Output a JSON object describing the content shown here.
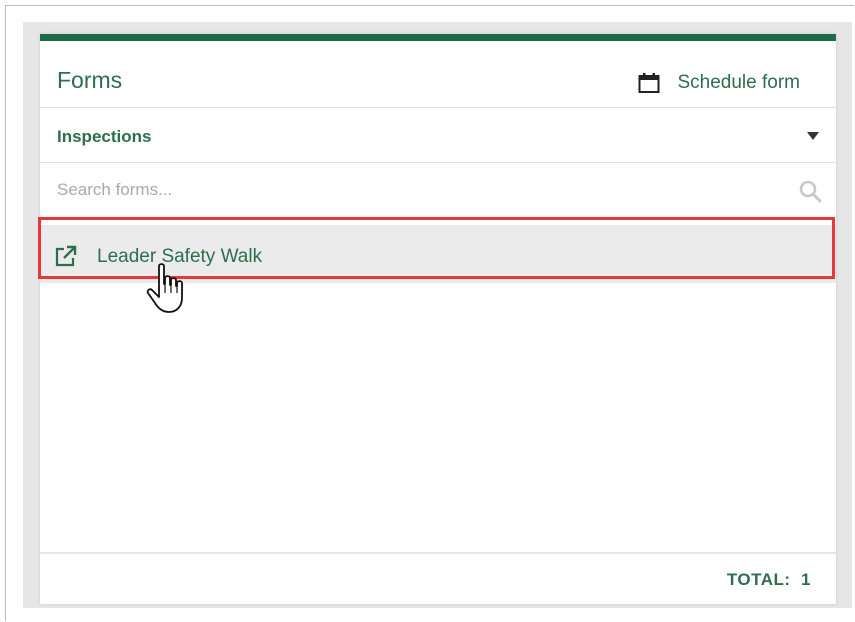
{
  "panel": {
    "title": "Forms",
    "accent_color": "#1e6b47",
    "schedule_button": {
      "label": "Schedule form",
      "icon": "calendar-icon"
    }
  },
  "category_select": {
    "selected": "Inspections",
    "icon": "caret-down-icon"
  },
  "search": {
    "placeholder": "Search forms...",
    "value": "",
    "icon": "search-icon"
  },
  "form_list": [
    {
      "label": "Leader Safety Walk",
      "icon": "external-link-icon",
      "highlighted": true,
      "highlight_color": "#e8373c"
    }
  ],
  "footer": {
    "total_label": "TOTAL:",
    "total_count": "1"
  },
  "cursor": {
    "icon": "hand-pointer-cursor"
  }
}
